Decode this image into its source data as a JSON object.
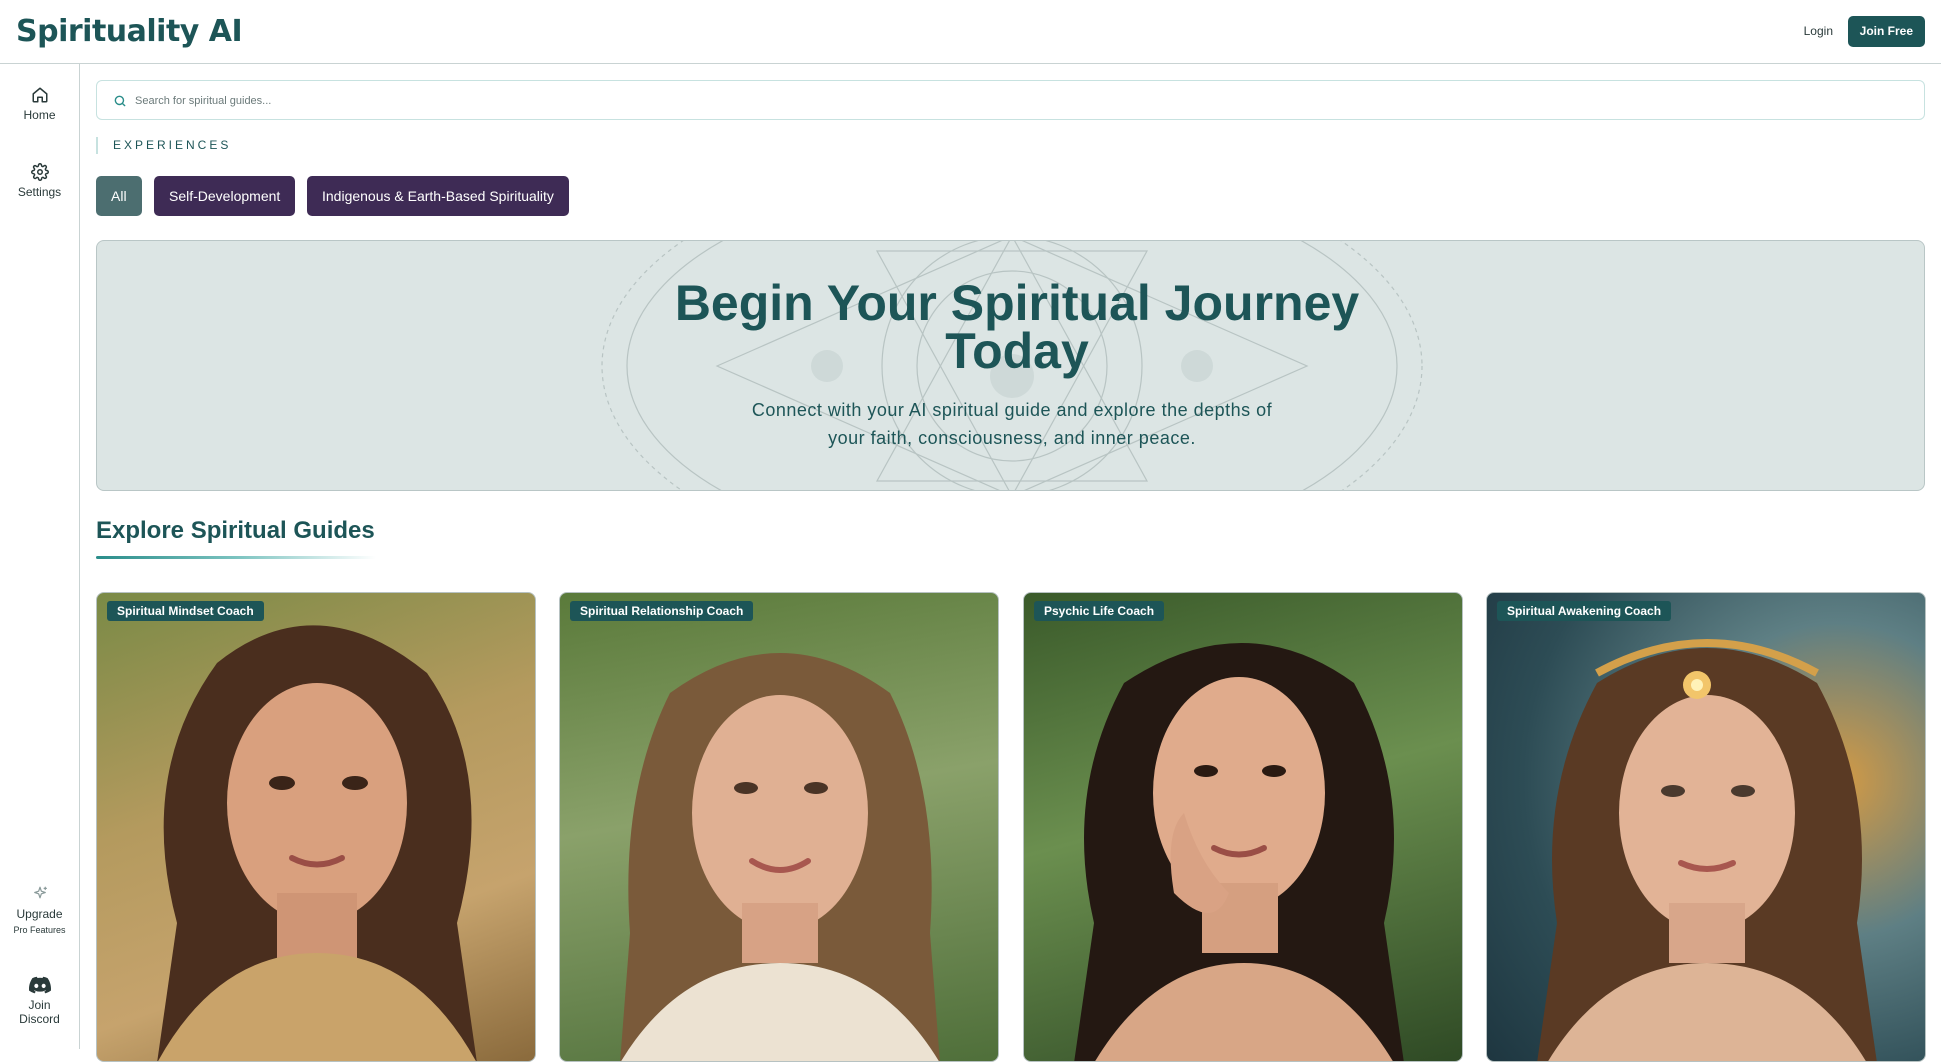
{
  "header": {
    "brand": "Spirituality AI",
    "login_label": "Login",
    "join_label": "Join Free"
  },
  "sidebar": {
    "items": [
      {
        "label": "Home",
        "icon": "home-icon"
      },
      {
        "label": "Settings",
        "icon": "gear-icon"
      }
    ],
    "upgrade": {
      "label": "Upgrade",
      "sub": "Pro Features",
      "icon": "sparkle-icon"
    },
    "discord": {
      "label_line1": "Join",
      "label_line2": "Discord",
      "icon": "discord-icon"
    }
  },
  "search": {
    "placeholder": "Search for spiritual guides...",
    "value": ""
  },
  "experiences": {
    "label": "EXPERIENCES",
    "chips": [
      "All",
      "Self-Development",
      "Indigenous & Earth-Based Spirituality"
    ],
    "selected": "All"
  },
  "hero": {
    "title": "Begin Your Spiritual Journey Today",
    "subtitle": "Connect with your AI spiritual guide and explore the depths of your faith, consciousness, and inner peace."
  },
  "guides": {
    "title": "Explore Spiritual Guides",
    "cards": [
      {
        "tag": "Spiritual Mindset Coach"
      },
      {
        "tag": "Spiritual Relationship Coach"
      },
      {
        "tag": "Psychic Life Coach"
      },
      {
        "tag": "Spiritual Awakening Coach"
      }
    ]
  },
  "colors": {
    "brand": "#1d5557",
    "chip_selected": "#4c6e70",
    "chip_default": "#3e2b55",
    "hero_bg": "#dce5e4"
  }
}
